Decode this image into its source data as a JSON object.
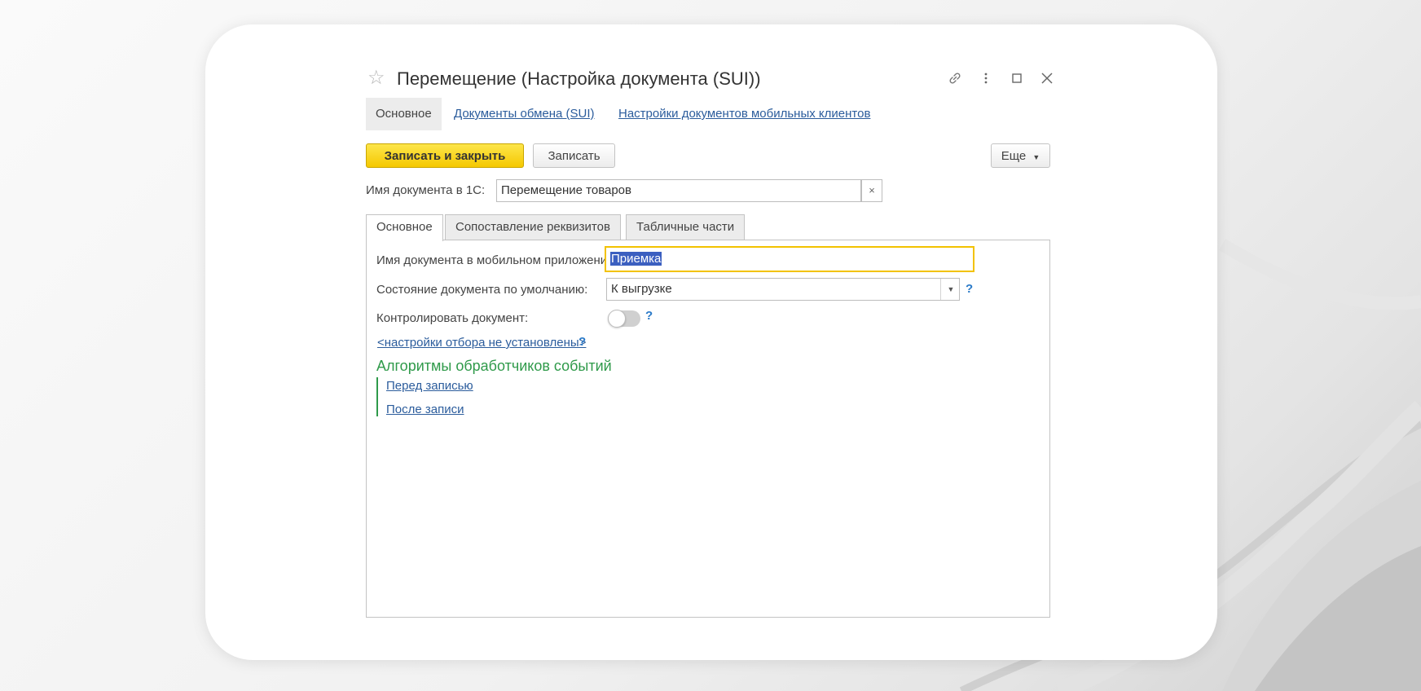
{
  "window": {
    "title": "Перемещение (Настройка документа (SUI))"
  },
  "nav": {
    "items": [
      {
        "label": "Основное"
      },
      {
        "label": "Документы обмена (SUI)"
      },
      {
        "label": "Настройки документов мобильных клиентов"
      }
    ]
  },
  "toolbar": {
    "save_close_label": "Записать и закрыть",
    "save_label": "Записать",
    "more_label": "Еще"
  },
  "doc_name_1c": {
    "label": "Имя документа в 1С:",
    "value": "Перемещение товаров"
  },
  "tabs": [
    {
      "label": "Основное"
    },
    {
      "label": "Сопоставление реквизитов"
    },
    {
      "label": "Табличные части"
    }
  ],
  "form": {
    "mobile_name": {
      "label": "Имя документа в мобильном приложении:",
      "value": "Приемка"
    },
    "default_state": {
      "label": "Состояние документа по умолчанию:",
      "value": "К выгрузке"
    },
    "control": {
      "label": "Контролировать документ:",
      "enabled": false
    },
    "filter_link": "<настройки отбора не установлены>",
    "help_mark": "?",
    "events": {
      "title": "Алгоритмы обработчиков событий",
      "before_save": "Перед записью",
      "after_save": "После записи"
    }
  },
  "colors": {
    "primary_button": "#f5c800",
    "link": "#2b5c9c",
    "group_title": "#2f9a4a",
    "focus_border": "#f2c200",
    "selection": "#3b5fc0"
  },
  "icons": [
    "star-icon",
    "link-icon",
    "more-vertical-icon",
    "maximize-icon",
    "close-icon",
    "dropdown-arrow-icon",
    "clear-icon"
  ]
}
